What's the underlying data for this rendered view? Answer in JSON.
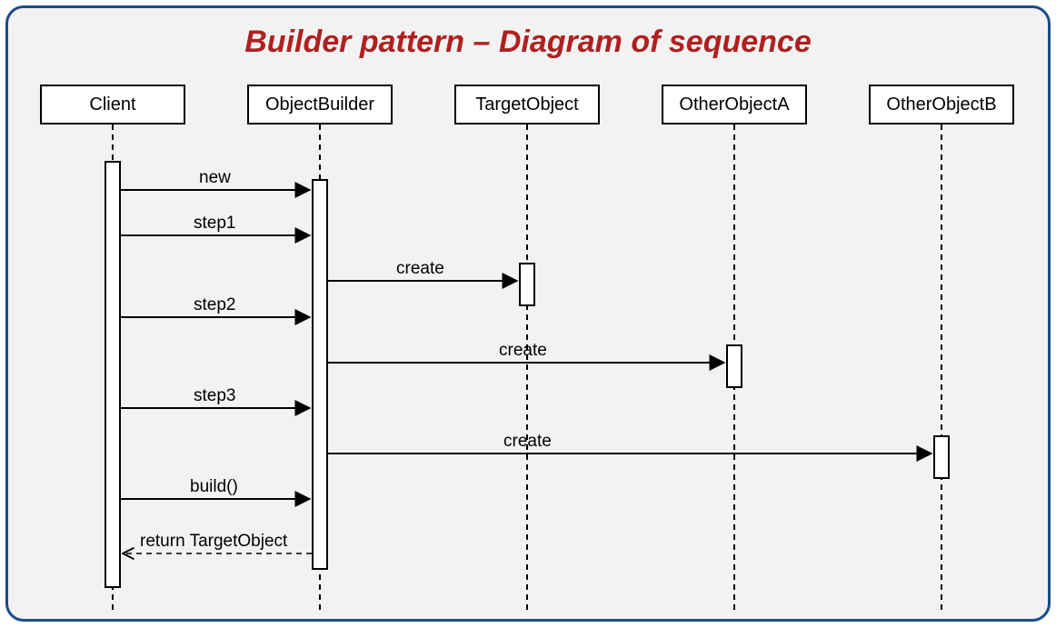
{
  "title": "Builder pattern – Diagram of sequence",
  "participants": {
    "client": "Client",
    "builder": "ObjectBuilder",
    "target": "TargetObject",
    "otherA": "OtherObjectA",
    "otherB": "OtherObjectB"
  },
  "messages": {
    "new": "new",
    "step1": "step1",
    "create1": "create",
    "step2": "step2",
    "create2": "create",
    "step3": "step3",
    "create3": "create",
    "build": "build()",
    "return": "return TargetObject"
  }
}
